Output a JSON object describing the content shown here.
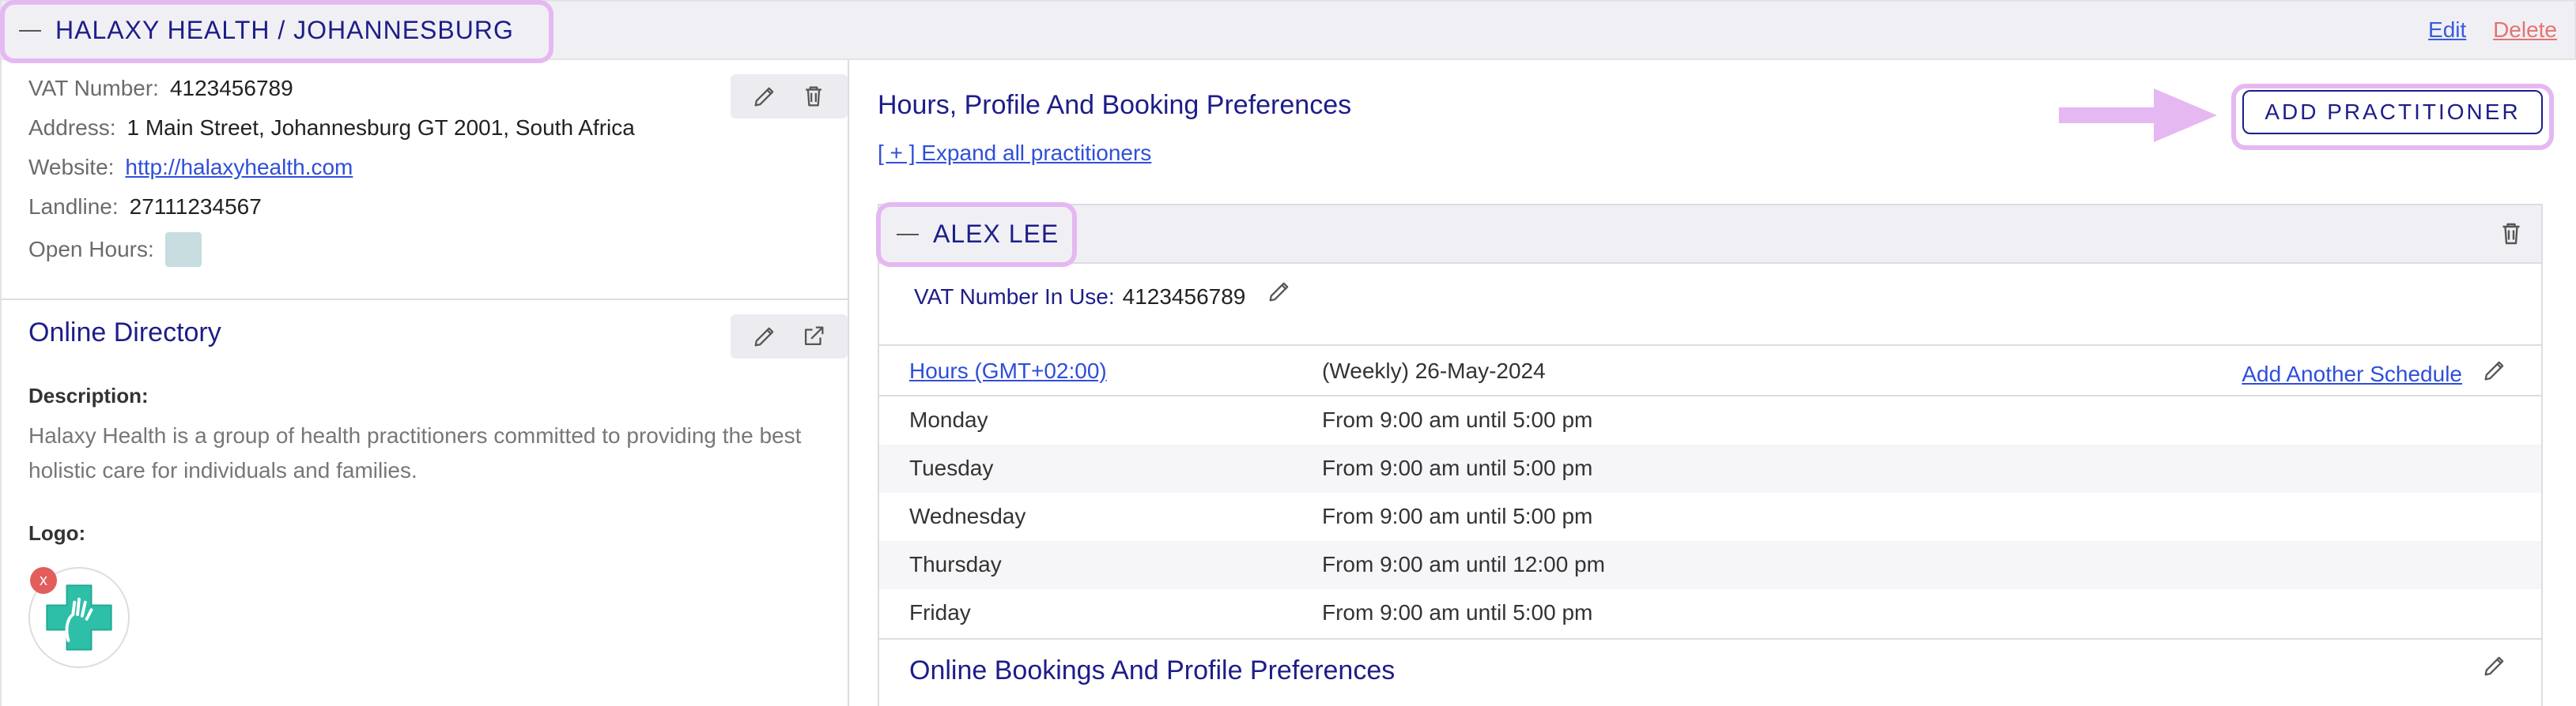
{
  "header": {
    "title": "HALAXY HEALTH / JOHANNESBURG",
    "edit_label": "Edit",
    "delete_label": "Delete"
  },
  "location": {
    "vat_label": "VAT Number:",
    "vat_value": "4123456789",
    "address_label": "Address:",
    "address_value": "1 Main Street, Johannesburg GT 2001, South Africa",
    "website_label": "Website:",
    "website_value": "http://halaxyhealth.com",
    "landline_label": "Landline:",
    "landline_value": "27111234567",
    "open_hours_label": "Open Hours:"
  },
  "directory": {
    "title": "Online Directory",
    "description_label": "Description:",
    "description_text": "Halaxy Health is a group of health practitioners committed to providing the best holistic care for individuals and families.",
    "logo_label": "Logo:",
    "logo_remove": "x"
  },
  "preferences": {
    "title": "Hours, Profile And Booking Preferences",
    "expand_label": "[ + ] Expand all practitioners",
    "add_button": "ADD PRACTITIONER"
  },
  "practitioner": {
    "name": "ALEX LEE",
    "vat_label": "VAT Number In Use:",
    "vat_value": "4123456789",
    "timezone_link": "Hours (GMT+02:00)",
    "schedule_label": "(Weekly) 26-May-2024",
    "add_schedule": "Add Another Schedule",
    "days": [
      {
        "day": "Monday",
        "hours": "From 9:00 am until 5:00 pm"
      },
      {
        "day": "Tuesday",
        "hours": "From 9:00 am until 5:00 pm"
      },
      {
        "day": "Wednesday",
        "hours": "From 9:00 am until 5:00 pm"
      },
      {
        "day": "Thursday",
        "hours": "From 9:00 am until 12:00 pm"
      },
      {
        "day": "Friday",
        "hours": "From 9:00 am until 5:00 pm"
      }
    ],
    "bookings_title": "Online Bookings And Profile Preferences"
  },
  "colors": {
    "brand_navy": "#1d1d8a",
    "link_blue": "#2f4fd8",
    "highlight": "#e5b8f2",
    "delete_red": "#e57373"
  }
}
